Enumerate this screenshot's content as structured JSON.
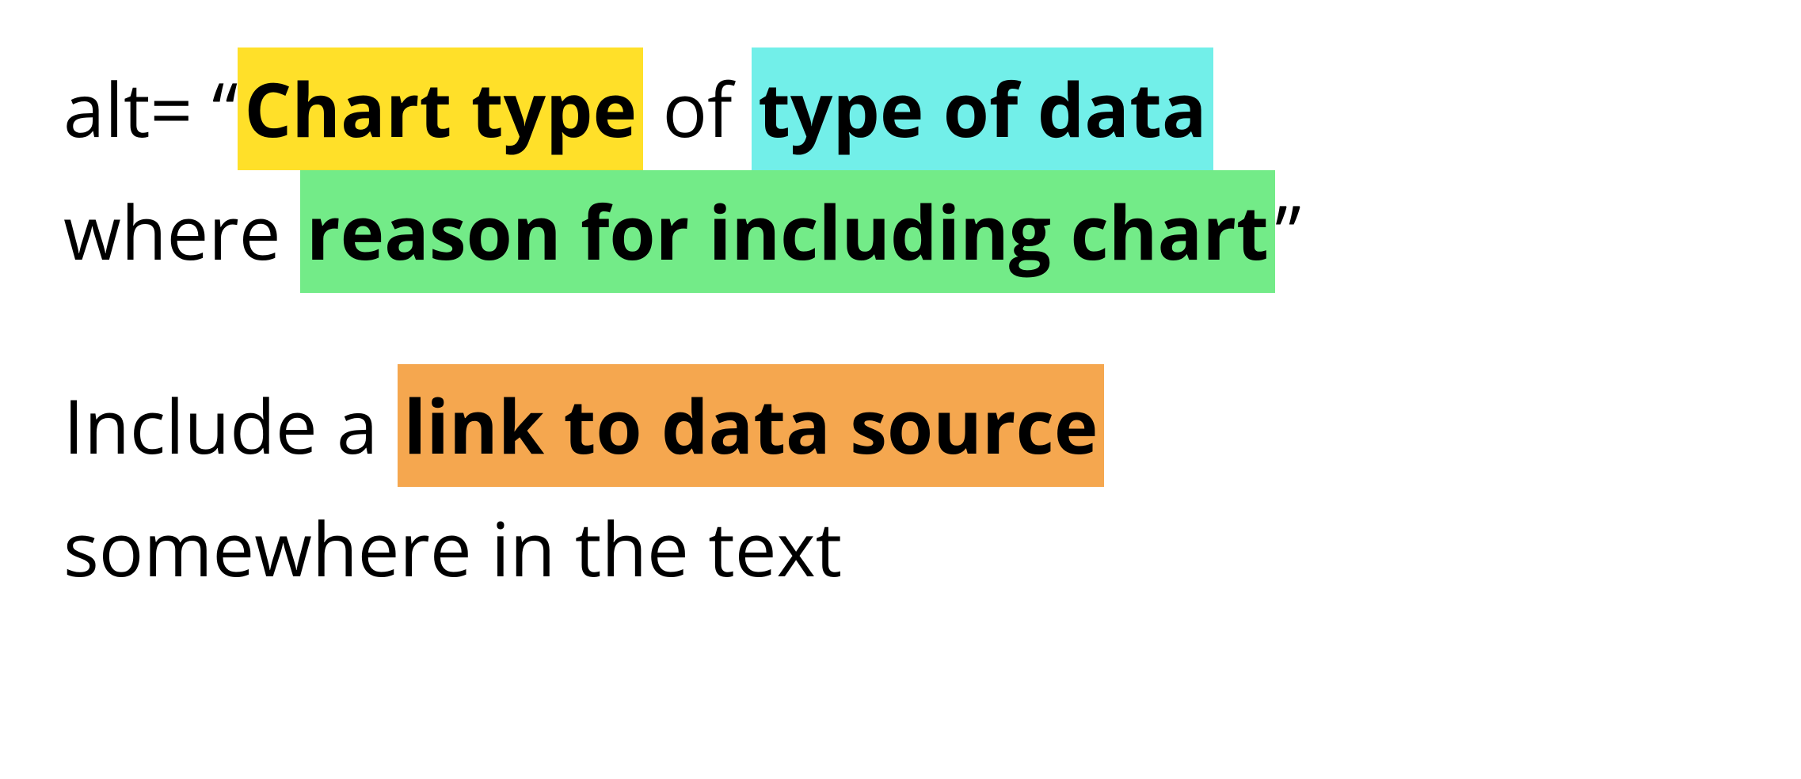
{
  "line1": {
    "prefix": "alt= “",
    "chart_type": "Chart type",
    "between1": " of ",
    "type_of_data": "type of data"
  },
  "line2": {
    "prefix": "where ",
    "reason": "reason for including chart",
    "suffix": "”"
  },
  "line3": {
    "prefix": "Include a ",
    "link": "link to data source"
  },
  "line4": {
    "text": "somewhere in the text"
  },
  "highlights": {
    "yellow": "#ffe029",
    "cyan": "#72efe9",
    "green": "#73eb88",
    "orange": "#f5a74f"
  }
}
